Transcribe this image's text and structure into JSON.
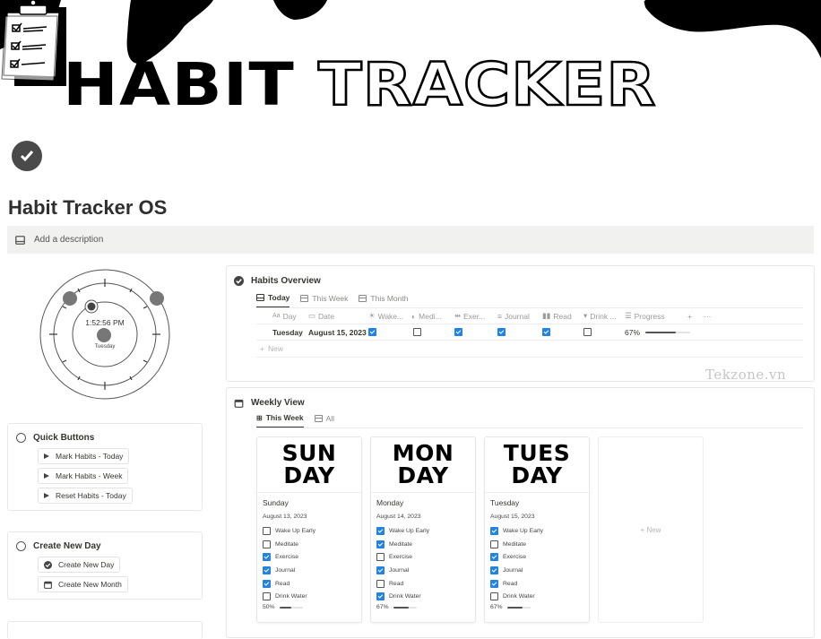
{
  "banner": {
    "title_solid": "HABIT",
    "title_outline": "TRACKER"
  },
  "page": {
    "title": "Habit Tracker OS",
    "description_placeholder": "Add a description"
  },
  "clock": {
    "time": "1:52:56 PM",
    "day": "Tuesday"
  },
  "quick_buttons": {
    "title": "Quick Buttons",
    "buttons": [
      {
        "label": "Mark Habits - Today",
        "icon": "play-icon"
      },
      {
        "label": "Mark Habits - Week",
        "icon": "play-icon"
      },
      {
        "label": "Reset Habits - Today",
        "icon": "play-icon"
      }
    ]
  },
  "create_new_day": {
    "title": "Create New Day",
    "buttons": [
      {
        "label": "Create New Day",
        "icon": "check-circle-icon"
      },
      {
        "label": "Create New Month",
        "icon": "calendar-icon"
      }
    ]
  },
  "habits_overview": {
    "title": "Habits Overview",
    "tabs": [
      {
        "label": "Today",
        "active": true
      },
      {
        "label": "This Week",
        "active": false
      },
      {
        "label": "This Month",
        "active": false
      }
    ],
    "columns": [
      "Day",
      "Date",
      "Wake...",
      "Medi...",
      "Exer...",
      "Journal",
      "Read",
      "Drink ...",
      "Progress"
    ],
    "column_icons": [
      "text-icon",
      "calendar-icon",
      "sun-icon",
      "meditate-icon",
      "dumbbell-icon",
      "journal-icon",
      "book-icon",
      "cup-icon",
      "progress-icon"
    ],
    "rows": [
      {
        "day": "Tuesday",
        "date": "August 15, 2023",
        "habits": [
          true,
          false,
          true,
          true,
          true,
          false
        ],
        "progress": "67%",
        "progress_value": 0.67
      }
    ],
    "new_label": "New",
    "add_column": "+",
    "more": "···"
  },
  "weekly_view": {
    "title": "Weekly View",
    "tabs": [
      {
        "label": "This Week",
        "active": true
      },
      {
        "label": "All",
        "active": false
      }
    ],
    "habit_names": [
      "Wake Up Early",
      "Meditate",
      "Exercise",
      "Journal",
      "Read",
      "Drink Water"
    ],
    "cards": [
      {
        "cover_line1": "SUN",
        "cover_line2": "DAY",
        "name": "Sunday",
        "date": "August 13, 2023",
        "habits": [
          false,
          false,
          true,
          true,
          true,
          false
        ],
        "progress": "50%",
        "progress_value": 0.5
      },
      {
        "cover_line1": "MON",
        "cover_line2": "DAY",
        "name": "Monday",
        "date": "August 14, 2023",
        "habits": [
          true,
          true,
          false,
          true,
          false,
          true
        ],
        "progress": "67%",
        "progress_value": 0.67
      },
      {
        "cover_line1": "TUES",
        "cover_line2": "DAY",
        "name": "Tuesday",
        "date": "August 15, 2023",
        "habits": [
          true,
          false,
          true,
          true,
          true,
          false
        ],
        "progress": "67%",
        "progress_value": 0.67
      }
    ],
    "new_label": "+ New"
  },
  "watermark": "Tekzone.vn",
  "colors": {
    "checkbox_checked": "#2383e2",
    "callout_bg": "#f1f1ef"
  }
}
